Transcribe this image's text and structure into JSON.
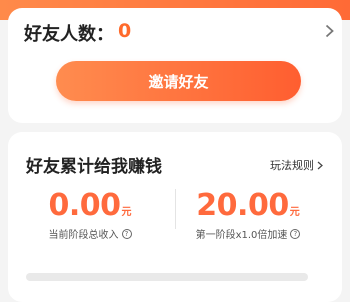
{
  "friends": {
    "label": "好友人数：",
    "count": "0"
  },
  "invite_button": {
    "label": "邀请好友"
  },
  "earnings": {
    "title": "好友累计给我赚钱",
    "rules_link": "玩法规则",
    "total_income": {
      "value": "0.00",
      "unit": "元",
      "caption": "当前阶段总收入"
    },
    "stage_bonus": {
      "value": "20.00",
      "unit": "元",
      "caption": "第一阶段x1.0倍加速"
    }
  },
  "colors": {
    "accent": "#ff6a3d",
    "button_start": "#ff8c4f",
    "button_end": "#ff5e30"
  },
  "icons": {
    "friends_chevron": "chevron-right-icon",
    "rules_chevron": "chevron-right-icon",
    "info": "question-circle-icon"
  }
}
